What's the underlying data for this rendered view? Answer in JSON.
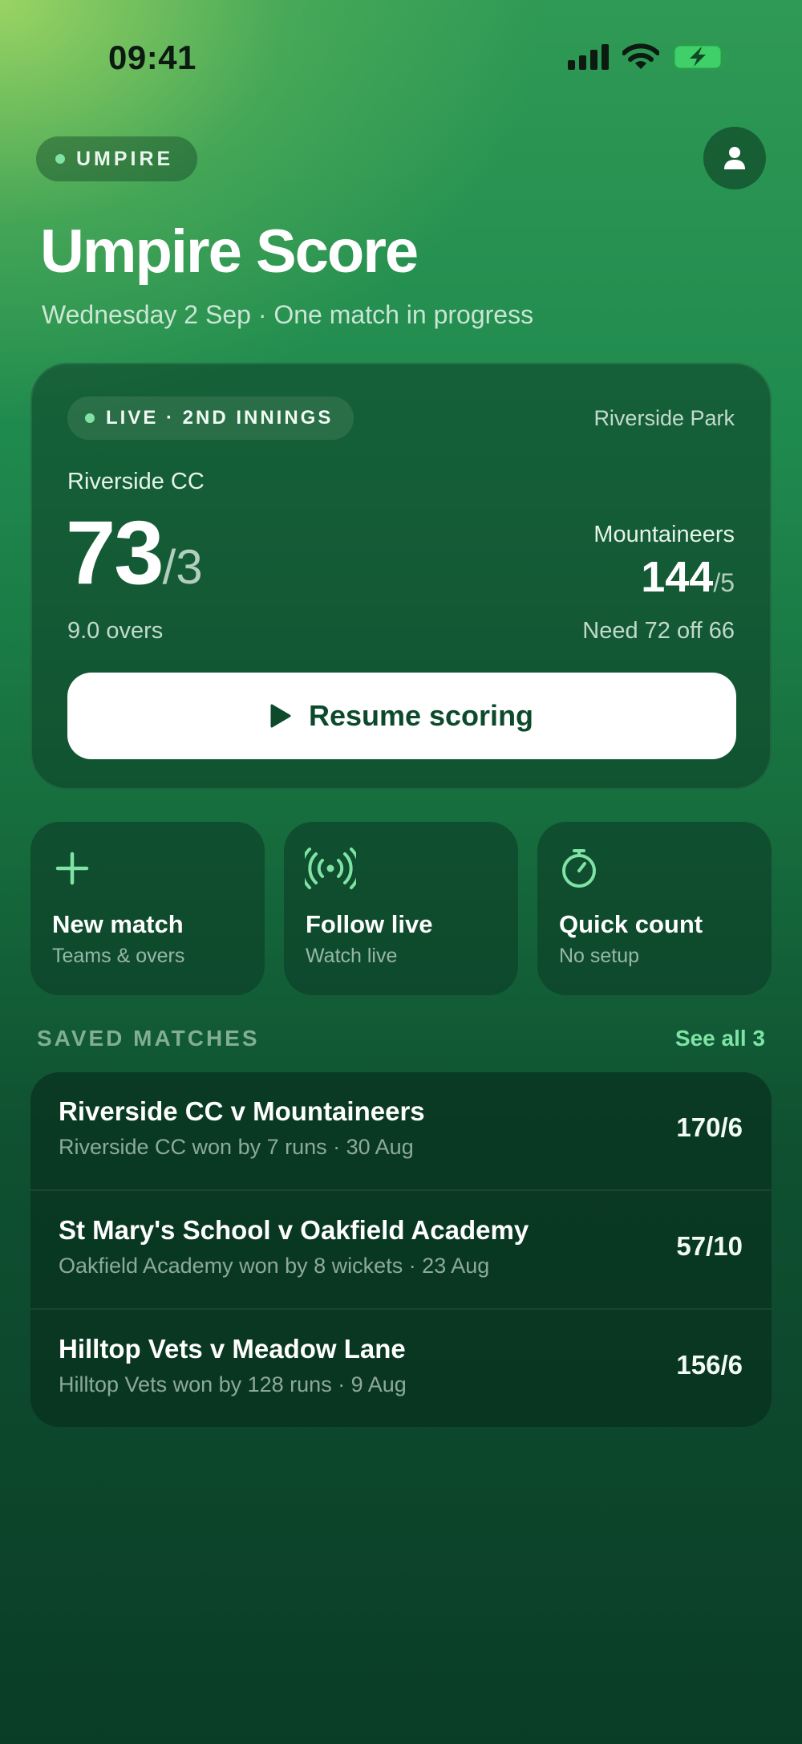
{
  "status_bar": {
    "time": "09:41",
    "icons": [
      "cellular-signal-icon",
      "wifi-icon",
      "battery-charging-icon"
    ]
  },
  "header": {
    "role_label": "UMPIRE",
    "title": "Umpire Score",
    "subtitle": "Wednesday 2 Sep · One match in progress",
    "avatar_icon": "person-icon"
  },
  "live_match": {
    "status_label": "LIVE · 2ND INNINGS",
    "venue": "Riverside Park",
    "batting": {
      "team": "Riverside CC",
      "runs": "73",
      "wickets": "/3",
      "overs": "9.0 overs"
    },
    "opponent": {
      "team": "Mountaineers",
      "runs": "144",
      "wickets": "/5"
    },
    "target_text": "Need 72 off 66",
    "resume_label": "Resume scoring",
    "resume_icon": "play-icon"
  },
  "actions": [
    {
      "label": "New match",
      "sub": "Teams & overs",
      "icon": "plus-icon"
    },
    {
      "label": "Follow live",
      "sub": "Watch live",
      "icon": "broadcast-icon"
    },
    {
      "label": "Quick count",
      "sub": "No setup",
      "icon": "stopwatch-icon"
    }
  ],
  "saved": {
    "section_title": "SAVED MATCHES",
    "see_all_label": "See all 3",
    "matches": [
      {
        "title": "Riverside CC v Mountaineers",
        "result": "Riverside CC won by 7 runs · 30 Aug",
        "score": "170/6"
      },
      {
        "title": "St Mary's School v Oakfield Academy",
        "result": "Oakfield Academy won by 8 wickets · 23 Aug",
        "score": "57/10"
      },
      {
        "title": "Hilltop Vets v Meadow Lane",
        "result": "Hilltop Vets won by 128 runs · 9 Aug",
        "score": "156/6"
      }
    ]
  },
  "colors": {
    "accent": "#7fe3a5",
    "button_text": "#0d4a2c",
    "battery": "#3fd06a"
  }
}
